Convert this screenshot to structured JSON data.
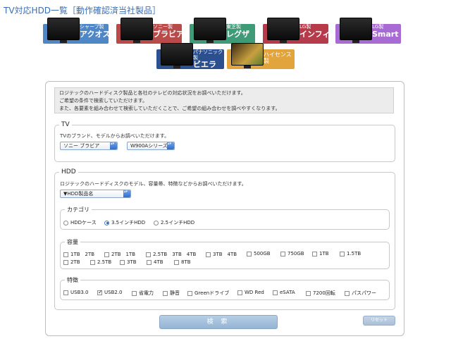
{
  "page_title": "TV対応HDD一覧［動作確認済当社製品］",
  "brands": [
    {
      "maker": "シャープ製",
      "name": "アクオス",
      "color": "#4f86c6"
    },
    {
      "maker": "ソニー製",
      "name": "ブラビア",
      "color": "#b84a4a"
    },
    {
      "maker": "東芝製",
      "name": "レグザ",
      "color": "#3f9a77"
    },
    {
      "maker": "LG製",
      "name": "インフィニア",
      "color": "#b53a4a"
    },
    {
      "maker": "LG製",
      "name": "Smart TV",
      "color": "#a86bd4"
    },
    {
      "maker": "パナソニック製",
      "name": "ビエラ",
      "color": "#2c4f8f"
    },
    {
      "maker": "",
      "name": "ハイセンス製",
      "color": "#e2a43c"
    }
  ],
  "intro_lines": [
    "ロジテックのハードディスク製品と各社のテレビの対応状況をお調べいただけます。",
    "ご希望の条件で検索していただけます。",
    "また、各要素を組み合わせて検索していただくことで、ご希望の組み合わせを調べやすくなります。"
  ],
  "tv": {
    "legend": "TV",
    "desc": "TVのブランド、モデルからお調べいただけます。",
    "brand_select": "ソニー ブラビア",
    "model_select": "W900Aシリーズ"
  },
  "hdd": {
    "legend": "HDD",
    "desc": "ロジテックのハードディスクのモデル、容量帯、特徴などからお調べいただけます。",
    "product_select": "▼HDD製品名",
    "category": {
      "legend": "カテゴリ",
      "options": [
        {
          "label": "HDDケース",
          "selected": false
        },
        {
          "label": "3.5インチHDD",
          "selected": true
        },
        {
          "label": "2.5インチHDD",
          "selected": false
        }
      ]
    },
    "capacity": {
      "legend": "容量",
      "row1": [
        "1TB　2TB",
        "2TB　1TB",
        "2.5TB　3TB　4TB",
        "3TB　4TB",
        "500GB",
        "750GB",
        "1TB",
        "1.5TB"
      ],
      "row2": [
        "2TB",
        "2.5TB",
        "3TB",
        "4TB",
        "8TB"
      ]
    },
    "features": {
      "legend": "特徴",
      "options": [
        {
          "label": "USB3.0",
          "checked": false
        },
        {
          "label": "USB2.0",
          "checked": true
        },
        {
          "label": "省電力",
          "checked": false
        },
        {
          "label": "静音",
          "checked": false
        },
        {
          "label": "Greenドライブ",
          "checked": false
        },
        {
          "label": "WD Red",
          "checked": false
        },
        {
          "label": "eSATA",
          "checked": false
        },
        {
          "label": "7200回転",
          "checked": false
        },
        {
          "label": "パスパワー",
          "checked": false
        }
      ]
    }
  },
  "buttons": {
    "search": "検 索",
    "reset": "リセット"
  }
}
